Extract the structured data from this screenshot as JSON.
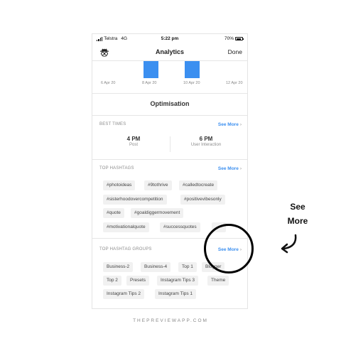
{
  "status_bar": {
    "carrier": "Telstra",
    "network": "4G",
    "time": "5:22 pm",
    "battery": "70%"
  },
  "nav": {
    "title": "Analytics",
    "done_label": "Done",
    "left_icon": "spy-icon"
  },
  "chart_data": {
    "type": "bar",
    "categories": [
      "6 Apr 20",
      "8 Apr 20",
      "10 Apr 20",
      "12 Apr 20"
    ],
    "visible_bars": [
      {
        "category": "8 Apr 20"
      },
      {
        "category": "10 Apr 20"
      }
    ],
    "bar_color": "#3b8ff0",
    "xlabel": "",
    "ylabel": ""
  },
  "optimisation": {
    "title": "Optimisation"
  },
  "best_times": {
    "label": "BEST TIMES",
    "see_more": "See More",
    "items": [
      {
        "time": "4 PM",
        "type": "Post"
      },
      {
        "time": "6 PM",
        "type": "User Interaction"
      }
    ]
  },
  "top_hashtags": {
    "label": "TOP HASHTAGS",
    "see_more": "See More",
    "tags": [
      "#photoideas",
      "#9tothrive",
      "#calledtocreate",
      "#sisterhoodovercompetition",
      "#positivevibesonly",
      "#quote",
      "#goaldiggermovement",
      "#motivationalquote",
      "#successquotes"
    ]
  },
  "top_hashtag_groups": {
    "label": "TOP HASHTAG GROUPS",
    "see_more": "See More",
    "groups": [
      "Business-2",
      "Business-4",
      "Top 1",
      "Blogger",
      "Top 2",
      "Presets",
      "Instagram Tips 3",
      "Theme",
      "Instagram Tips 2",
      "Instagram Tips 1"
    ]
  },
  "annotation": {
    "text_line1": "See",
    "text_line2": "More"
  },
  "footer": {
    "text": "THEPREVIEWAPP.COM"
  },
  "colors": {
    "accent": "#3b8ff0",
    "chip_bg": "#f1f1f1"
  }
}
